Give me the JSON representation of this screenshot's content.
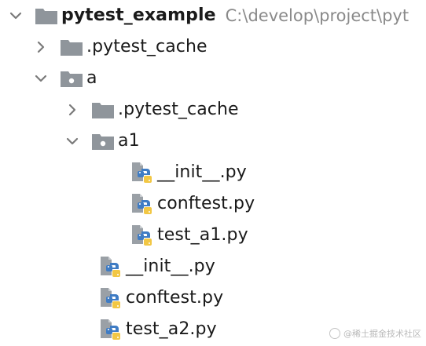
{
  "project": {
    "name": "pytest_example",
    "path": "C:\\develop\\project\\pyt"
  },
  "nodes": [
    {
      "label": ".pytest_cache",
      "kind": "folder",
      "state": "collapsed"
    },
    {
      "label": "a",
      "kind": "package",
      "state": "expanded"
    },
    {
      "label": ".pytest_cache",
      "kind": "folder",
      "state": "collapsed"
    },
    {
      "label": "a1",
      "kind": "package",
      "state": "expanded"
    },
    {
      "label": "__init__.py",
      "kind": "python-file"
    },
    {
      "label": "conftest.py",
      "kind": "python-file"
    },
    {
      "label": "test_a1.py",
      "kind": "python-file"
    },
    {
      "label": "__init__.py",
      "kind": "python-file"
    },
    {
      "label": "conftest.py",
      "kind": "python-file"
    },
    {
      "label": "test_a2.py",
      "kind": "python-file"
    }
  ],
  "watermark": "@稀土掘金技术社区",
  "colors": {
    "folder": "#8f959b",
    "package_dot": "#ffffff",
    "python_blue": "#3f7cc4",
    "python_yellow": "#f2c744",
    "file_paper": "#9aa0a6",
    "chevron": "#7a7a7a"
  }
}
